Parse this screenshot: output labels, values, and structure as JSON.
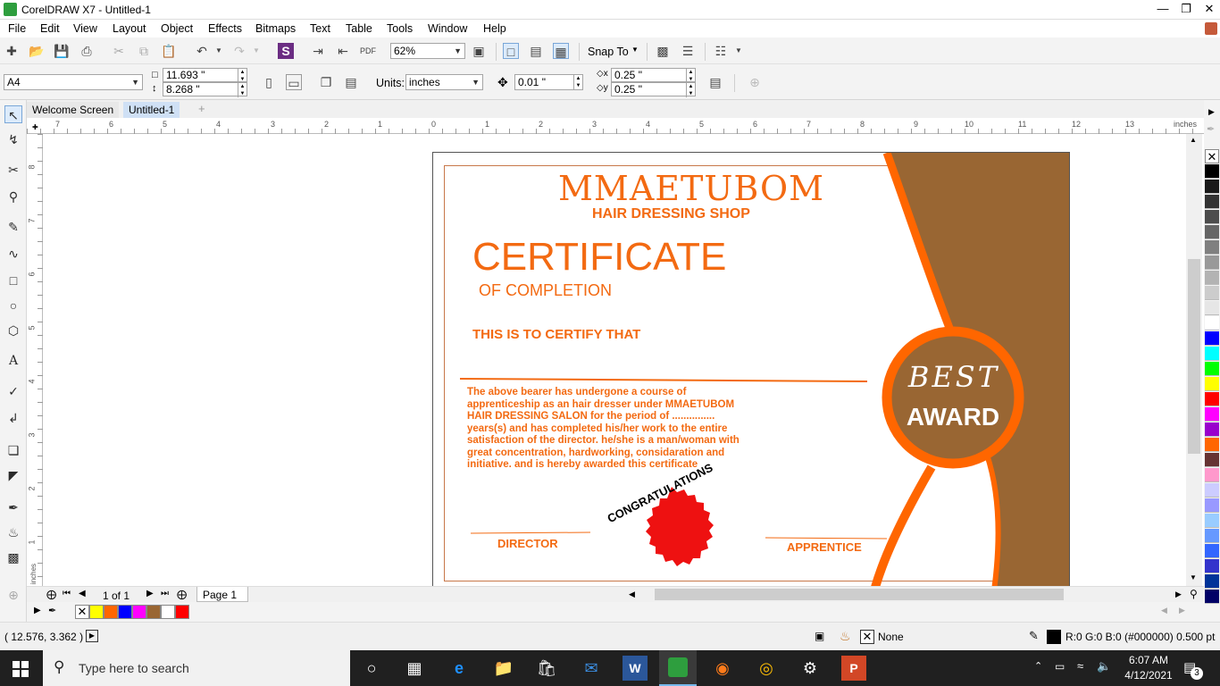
{
  "window": {
    "title": "CorelDRAW X7 - Untitled-1"
  },
  "menu": [
    "File",
    "Edit",
    "View",
    "Layout",
    "Object",
    "Effects",
    "Bitmaps",
    "Text",
    "Table",
    "Tools",
    "Window",
    "Help"
  ],
  "toolbar": {
    "zoom": "62%",
    "snap": "Snap To"
  },
  "property_bar": {
    "page_size": "A4",
    "width": "11.693 \"",
    "height": "8.268 \"",
    "units_label": "Units:",
    "units": "inches",
    "nudge": "0.01 \"",
    "dup_x": "0.25 \"",
    "dup_y": "0.25 \""
  },
  "tabs": [
    "Welcome Screen",
    "Untitled-1"
  ],
  "ruler": {
    "h_labels": [
      "7",
      "6",
      "5",
      "4",
      "3",
      "2",
      "1",
      "0",
      "1",
      "2",
      "3",
      "4",
      "5",
      "6",
      "7",
      "8",
      "9",
      "10",
      "11",
      "12",
      "13"
    ],
    "v_labels": [
      "8",
      "7",
      "6",
      "5",
      "4",
      "3",
      "2",
      "1"
    ],
    "unit": "inches"
  },
  "page_nav": {
    "counter": "1 of 1",
    "page_tab": "Page 1"
  },
  "doc_palette": [
    "#ffff00",
    "#ff6600",
    "#0000ff",
    "#ff00ff",
    "#996633",
    "#ffffff",
    "#ff0000"
  ],
  "color_palette": [
    "#000000",
    "#1a1a1a",
    "#333333",
    "#4d4d4d",
    "#666666",
    "#808080",
    "#999999",
    "#b3b3b3",
    "#cccccc",
    "#e6e6e6",
    "#ffffff",
    "#0000ff",
    "#00ffff",
    "#00ff00",
    "#ffff00",
    "#ff0000",
    "#ff00ff",
    "#9900cc",
    "#ff6600",
    "#663333",
    "#ff99cc",
    "#ccccff",
    "#9999ff",
    "#99ccff",
    "#6699ff",
    "#3366ff",
    "#3333cc",
    "#003399",
    "#000066"
  ],
  "certificate": {
    "shop_name": "MMAETUBOM",
    "shop_sub": "HAIR DRESSING SHOP",
    "title": "CERTIFICATE",
    "subtitle": "OF COMPLETION",
    "certify": "THIS IS TO CERTIFY THAT",
    "body_lines": [
      "The above bearer has undergone a course of",
      "apprenticeship as an hair dresser under MMAETUBOM",
      "HAIR DRESSING SALON for the period of ...............",
      "years(s) and has completed his/her work to the entire",
      "satisfaction of the director. he/she is a man/woman with",
      "great concentration, hardworking, considaration and",
      "initiative. and is hereby awarded this certificate"
    ],
    "director": "DIRECTOR",
    "apprentice": "APPRENTICE",
    "seal": "CONGRATULATIONS",
    "badge_top": "BEST",
    "badge_bottom": "AWARD",
    "colors": {
      "orange": "#f36a12",
      "brown": "#996633",
      "red": "#ee1111"
    }
  },
  "status": {
    "coords": "( 12.576, 3.362 )",
    "fill": "None",
    "outline": "R:0 G:0 B:0 (#000000)  0.500 pt"
  },
  "taskbar": {
    "search": "Type here to search",
    "time": "6:07 AM",
    "date": "4/12/2021",
    "notifications": "3"
  }
}
